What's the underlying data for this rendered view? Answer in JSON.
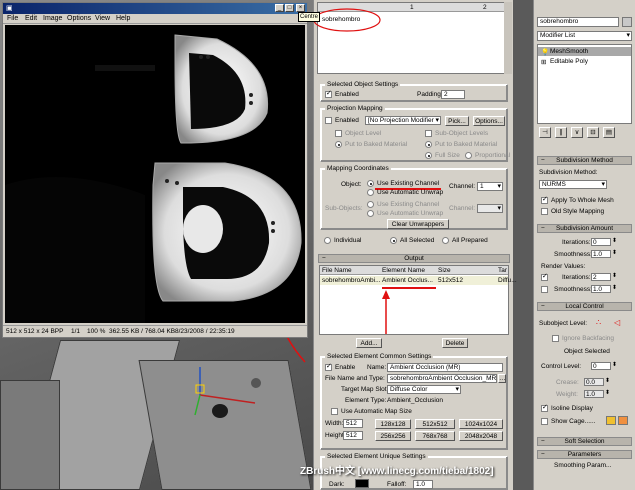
{
  "framebuffer": {
    "title": "",
    "menu": [
      "File",
      "Edit",
      "Image",
      "Options",
      "View",
      "Help"
    ],
    "status": {
      "size": "512 x 512 x 24 BPP",
      "frame": "1/1",
      "zoom": "100 %",
      "memory": "362.55 KB / 768.04 KB",
      "datetime": "8/23/2008 / 22:35:19"
    },
    "tooltip": "Centre"
  },
  "rtt": {
    "object_name": "sobrehombro",
    "col1": "1",
    "col2": "2",
    "selected_object_settings": {
      "title": "Selected Object Settings",
      "enabled": "Enabled",
      "padding_label": "Padding:",
      "padding_value": "2"
    },
    "projection_mapping": {
      "title": "Projection Mapping",
      "enabled": "Enabled",
      "modifier": "[No Projection Modifier",
      "pick": "Pick...",
      "options": "Options...",
      "object_level": "Object Level",
      "sub_object_levels": "Sub-Object Levels",
      "put_baked": "Put to Baked Material",
      "put_baked2": "Put to Baked Material",
      "full_size": "Full Size",
      "proportional": "Proportional"
    },
    "mapping_coordinates": {
      "title": "Mapping Coordinates",
      "object_label": "Object:",
      "use_existing": "Use Existing Channel",
      "use_auto": "Use Automatic Unwrap",
      "channel_label": "Channel:",
      "channel_value": "1",
      "sub_objects_label": "Sub-Objects:",
      "sub_use_existing": "Use Existing Channel",
      "sub_use_auto": "Use Automatic Unwrap",
      "sub_channel_label": "Channel:",
      "clear_unwrappers": "Clear Unwrappers"
    },
    "scope": {
      "individual": "Individual",
      "all_selected": "All Selected",
      "all_prepared": "All Prepared"
    },
    "output": {
      "title": "Output",
      "headers": [
        "File Name",
        "Element Name",
        "Size",
        "Tar"
      ],
      "row": [
        "sobrehombroAmbi...",
        "Ambient Occlus...",
        "512x512",
        "Diffu..."
      ],
      "add": "Add...",
      "delete": "Delete"
    },
    "element_common": {
      "title": "Selected Element Common Settings",
      "enable": "Enable",
      "name_label": "Name:",
      "name_value": "Ambient Occlusion (MR)",
      "file_label": "File Name and Type:",
      "file_value": "sobrehombroAmbient Occlusion_MR",
      "target_label": "Target Map Slot:",
      "target_value": "Diffuse Color",
      "element_type_label": "Element Type:",
      "element_type_value": "Ambient_Occlusion",
      "use_auto_size": "Use Automatic Map Size",
      "width_label": "Width:",
      "width_value": "512",
      "height_label": "Height:",
      "height_value": "512",
      "sizes": [
        "128x128",
        "512x512",
        "1024x1024",
        "256x256",
        "768x768",
        "2048x2048"
      ]
    },
    "element_unique": {
      "title": "Selected Element Unique Settings",
      "dark": "Dark:",
      "falloff": "Falloff:",
      "falloff_value": "1.0"
    }
  },
  "modifier_panel": {
    "name": "sobrehombro",
    "list_label": "Modifier List",
    "stack": [
      "MeshSmooth",
      "Editable Poly"
    ],
    "subdivision_method": {
      "title": "Subdivision Method",
      "label": "Subdivision Method:",
      "value": "NURMS",
      "apply_whole": "Apply To Whole Mesh",
      "old_style": "Old Style Mapping"
    },
    "subdivision_amount": {
      "title": "Subdivision Amount",
      "iterations_label": "Iterations:",
      "iterations_value": "0",
      "smoothness_label": "Smoothness:",
      "smoothness_value": "1.0",
      "render_values": "Render Values:",
      "r_iterations_label": "Iterations:",
      "r_iterations_value": "2",
      "r_smoothness_label": "Smoothness:",
      "r_smoothness_value": "1.0"
    },
    "local_control": {
      "title": "Local Control",
      "subobject_level": "Subobject Level:",
      "ignore_backfacing": "Ignore Backfacing",
      "object_selected": "Object Selected",
      "control_level_label": "Control Level:",
      "control_level_value": "0",
      "crease_label": "Crease:",
      "crease_value": "0.0",
      "weight_label": "Weight:",
      "weight_value": "1.0",
      "isoline": "Isoline Display",
      "show_cage": "Show Cage......"
    },
    "soft_selection": "Soft Selection",
    "parameters": "Parameters",
    "smoothing": "Smoothing Param..."
  },
  "watermark": "ZBrush中文 [www.linecg.com/tieba/1802]",
  "colors": {
    "title_bar": "#0a246a",
    "panel": "#d4d0c8",
    "red_mark": "#e01010",
    "green_arrow": "#2db02d",
    "blue_axis": "#2050c0"
  }
}
